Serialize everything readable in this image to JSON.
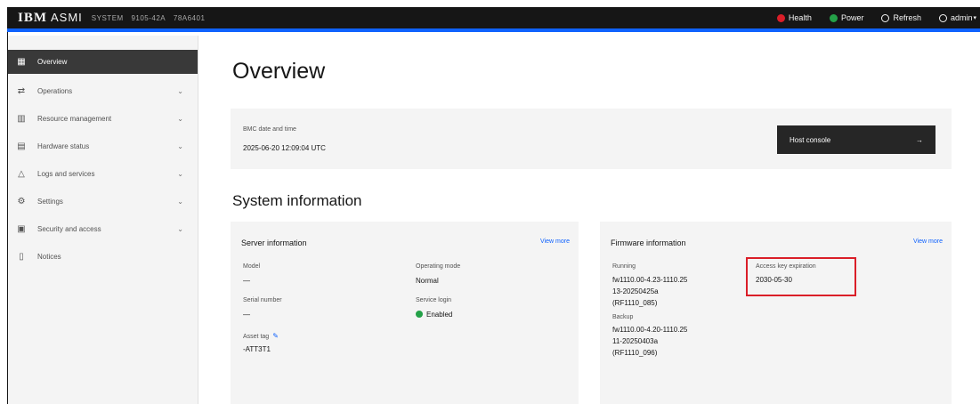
{
  "header": {
    "brand": "IBM",
    "product": "ASMI",
    "server_fields": [
      "SYSTEM",
      "9105-42A",
      "78A6401"
    ],
    "actions": [
      {
        "label": "Health",
        "icon": "health-icon",
        "color": "#da1e28"
      },
      {
        "label": "Power",
        "icon": "power-icon",
        "color": "#24a148"
      },
      {
        "label": "Refresh",
        "icon": "refresh-icon"
      },
      {
        "label": "admin",
        "icon": "user-icon"
      }
    ],
    "accent_color": "#0f62fe"
  },
  "sidebar": {
    "items": [
      {
        "label": "Overview",
        "icon": "overview-icon",
        "active": true
      },
      {
        "label": "Operations",
        "icon": "operations-icon",
        "expandable": true
      },
      {
        "label": "Resource management",
        "icon": "resource-management-icon",
        "expandable": true
      },
      {
        "label": "Hardware status",
        "icon": "hardware-status-icon",
        "expandable": true
      },
      {
        "label": "Logs and services",
        "icon": "logs-icon",
        "expandable": true
      },
      {
        "label": "Settings",
        "icon": "settings-icon",
        "expandable": true
      },
      {
        "label": "Security and access",
        "icon": "security-icon",
        "expandable": true
      },
      {
        "label": "Notices",
        "icon": "notices-icon"
      }
    ]
  },
  "main": {
    "title": "Overview",
    "datetime": {
      "label": "BMC date and time",
      "value": "2025-06-20 12:09:04 UTC",
      "button": "Host console",
      "button_arrow": "→"
    },
    "system_info_title": "System information",
    "server_card": {
      "title": "Server information",
      "view_more": "View more",
      "fields": {
        "model_label": "Model",
        "model_value": "—",
        "serial_label": "Serial number",
        "serial_value": "—",
        "asset_label": "Asset tag",
        "asset_value": "-ATT3T1",
        "mode_label": "Operating mode",
        "mode_value": "Normal",
        "service_label": "Service login",
        "service_value": "Enabled"
      }
    },
    "firmware_card": {
      "title": "Firmware information",
      "view_more": "View more",
      "running_label": "Running",
      "running_lines": [
        "fw1110.00-4.23-1110.25",
        "13-20250425a",
        "(RF1110_085)"
      ],
      "backup_label": "Backup",
      "backup_lines": [
        "fw1110.00-4.20-1110.25",
        "11-20250403a",
        "(RF1110_096)"
      ],
      "access_key_label": "Access key expiration",
      "access_key_value": "2030-05-30",
      "highlight_color": "#da1e28"
    }
  }
}
